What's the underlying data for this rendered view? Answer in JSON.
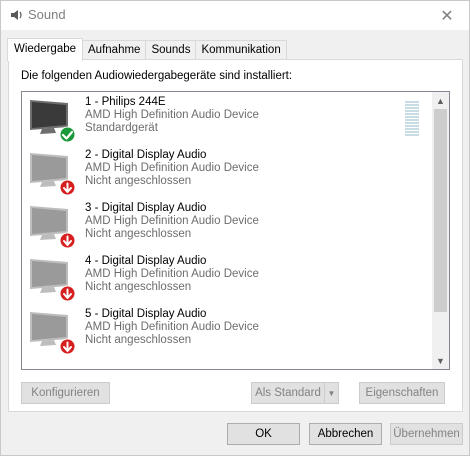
{
  "window": {
    "title": "Sound",
    "close_glyph": "✕"
  },
  "tabs": [
    {
      "label": "Wiedergabe",
      "active": true
    },
    {
      "label": "Aufnahme",
      "active": false
    },
    {
      "label": "Sounds",
      "active": false
    },
    {
      "label": "Kommunikation",
      "active": false
    }
  ],
  "panel": {
    "instruction": "Die folgenden Audiowiedergabegeräte sind installiert:"
  },
  "devices": [
    {
      "name": "1 - Philips 244E",
      "driver": "AMD High Definition Audio Device",
      "status": "Standardgerät",
      "badge": "check-icon",
      "enabled": true
    },
    {
      "name": "2 - Digital Display Audio",
      "driver": "AMD High Definition Audio Device",
      "status": "Nicht angeschlossen",
      "badge": "down-arrow-icon",
      "enabled": false
    },
    {
      "name": "3 - Digital Display Audio",
      "driver": "AMD High Definition Audio Device",
      "status": "Nicht angeschlossen",
      "badge": "down-arrow-icon",
      "enabled": false
    },
    {
      "name": "4 - Digital Display Audio",
      "driver": "AMD High Definition Audio Device",
      "status": "Nicht angeschlossen",
      "badge": "down-arrow-icon",
      "enabled": false
    },
    {
      "name": "5 - Digital Display Audio",
      "driver": "AMD High Definition Audio Device",
      "status": "Nicht angeschlossen",
      "badge": "down-arrow-icon",
      "enabled": false
    }
  ],
  "buttons": {
    "configure": "Konfigurieren",
    "set_default": "Als Standard",
    "properties": "Eigenschaften",
    "ok": "OK",
    "cancel": "Abbrechen",
    "apply": "Übernehmen"
  },
  "colors": {
    "check_badge": "#1a9a3a",
    "down_badge": "#d61f1f",
    "accent": "#0078d7"
  }
}
